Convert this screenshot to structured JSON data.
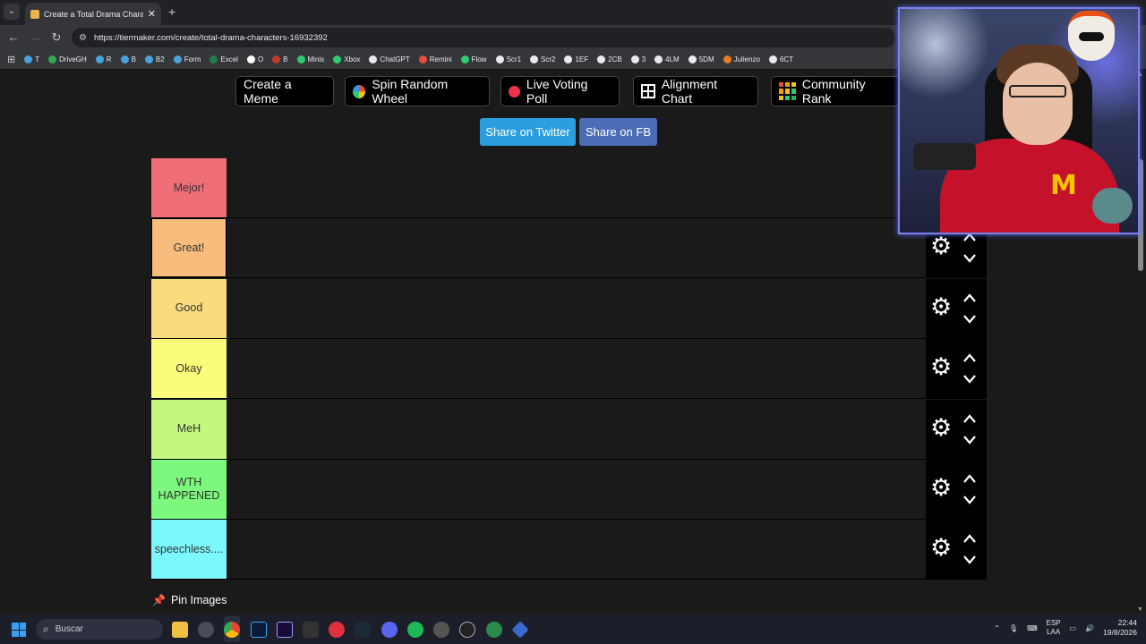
{
  "browser": {
    "tab_title": "Create a Total Drama Character",
    "url": "https://tiermaker.com/create/total-drama-characters-16932392",
    "bookmarks": [
      "T",
      "DriveGH",
      "R",
      "B",
      "B2",
      "Form",
      "Excel",
      "O",
      "B",
      "Minis",
      "Xbox",
      "ChatGPT",
      "Remini",
      "Flow",
      "Scr1",
      "Scr2",
      "1EF",
      "2CB",
      "3",
      "4LM",
      "5DM",
      "Julienzo",
      "6CT"
    ]
  },
  "top_buttons": {
    "create_meme": "Create a Meme",
    "spin_wheel": "Spin Random Wheel",
    "live_poll": "Live Voting Poll",
    "alignment": "Alignment Chart",
    "community": "Community Rank"
  },
  "share": {
    "twitter": "Share on Twitter",
    "fb": "Share on FB"
  },
  "tiers": [
    {
      "label": "Mejor!",
      "color": "#f06e78"
    },
    {
      "label": "Great!",
      "color": "#f8bd7c"
    },
    {
      "label": "Good",
      "color": "#fadc7e"
    },
    {
      "label": "Okay",
      "color": "#fcfc7c"
    },
    {
      "label": "MeH",
      "color": "#c4f77e"
    },
    {
      "label": "WTH HAPPENED",
      "color": "#7cf87c"
    },
    {
      "label": "speechless....",
      "color": "#7cf8fc"
    }
  ],
  "pin_images": "Pin Images",
  "taskbar": {
    "search_placeholder": "Buscar",
    "lang_line1": "ESP",
    "lang_line2": "LAA",
    "time": "22:44",
    "date": "19/8/2026"
  },
  "colors": {
    "twitter": "#2b9ee0",
    "facebook": "#4a6db5",
    "webcam_border": "#7b7ff0"
  }
}
